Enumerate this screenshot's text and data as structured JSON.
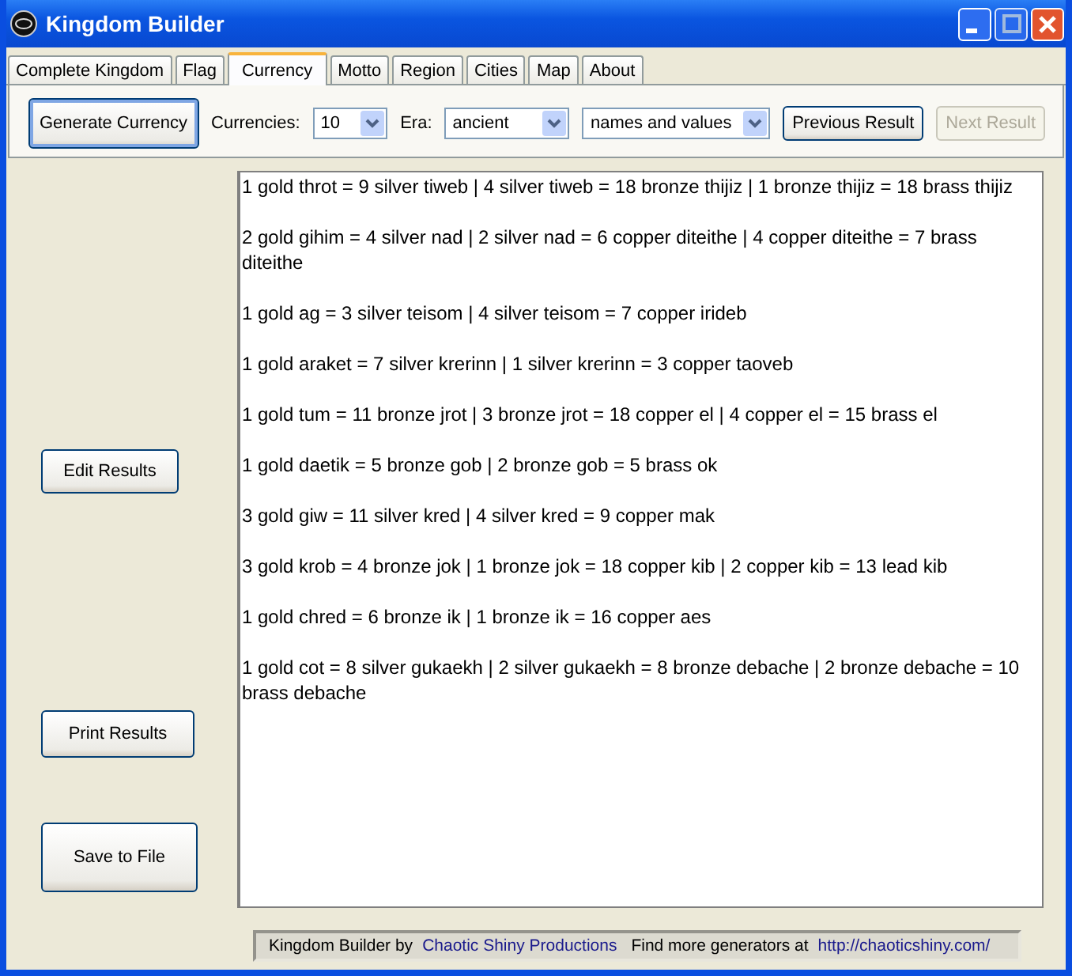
{
  "window": {
    "title": "Kingdom Builder"
  },
  "tabs": [
    {
      "label": "Complete Kingdom",
      "selected": false
    },
    {
      "label": "Flag",
      "selected": false
    },
    {
      "label": "Currency",
      "selected": true
    },
    {
      "label": "Motto",
      "selected": false
    },
    {
      "label": "Region",
      "selected": false
    },
    {
      "label": "Cities",
      "selected": false
    },
    {
      "label": "Map",
      "selected": false
    },
    {
      "label": "About",
      "selected": false
    }
  ],
  "toolbar": {
    "generate_button": "Generate Currency",
    "currencies_label": "Currencies:",
    "currencies_value": "10",
    "era_label": "Era:",
    "era_value": "ancient",
    "format_value": "names and values",
    "buttons": [
      {
        "label": "Previous Result",
        "disabled": false
      },
      {
        "label": "Next Result",
        "disabled": true
      }
    ]
  },
  "side_buttons": {
    "edit": "Edit Results",
    "print": "Print Results",
    "save": "Save to File"
  },
  "results": [
    "1 gold throt = 9 silver tiweb | 4 silver tiweb = 18 bronze thijiz | 1 bronze thijiz = 18 brass thijiz",
    "2 gold gihim = 4 silver nad | 2 silver nad = 6 copper diteithe | 4 copper diteithe = 7 brass diteithe",
    "1 gold ag = 3 silver teisom | 4 silver teisom = 7 copper irideb",
    "1 gold araket = 7 silver krerinn | 1 silver krerinn = 3 copper taoveb",
    "1 gold tum = 11 bronze jrot | 3 bronze jrot = 18 copper el | 4 copper el = 15 brass el",
    "1 gold daetik = 5 bronze gob | 2 bronze gob = 5 brass ok",
    "3 gold giw = 11 silver kred | 4 silver kred = 9 copper mak",
    "3 gold krob = 4 bronze jok | 1 bronze jok = 18 copper kib | 2 copper kib = 13 lead kib",
    "1 gold chred = 6 bronze ik | 1 bronze ik = 16 copper aes",
    "1 gold cot = 8 silver gukaekh | 2 silver gukaekh = 8 bronze debache | 2 bronze debache = 10 brass debache"
  ],
  "footer": {
    "credit": "Kingdom Builder by",
    "credit_link": "Chaotic Shiny Productions",
    "more": "Find more generators at",
    "more_link": "http://chaoticshiny.com/"
  }
}
